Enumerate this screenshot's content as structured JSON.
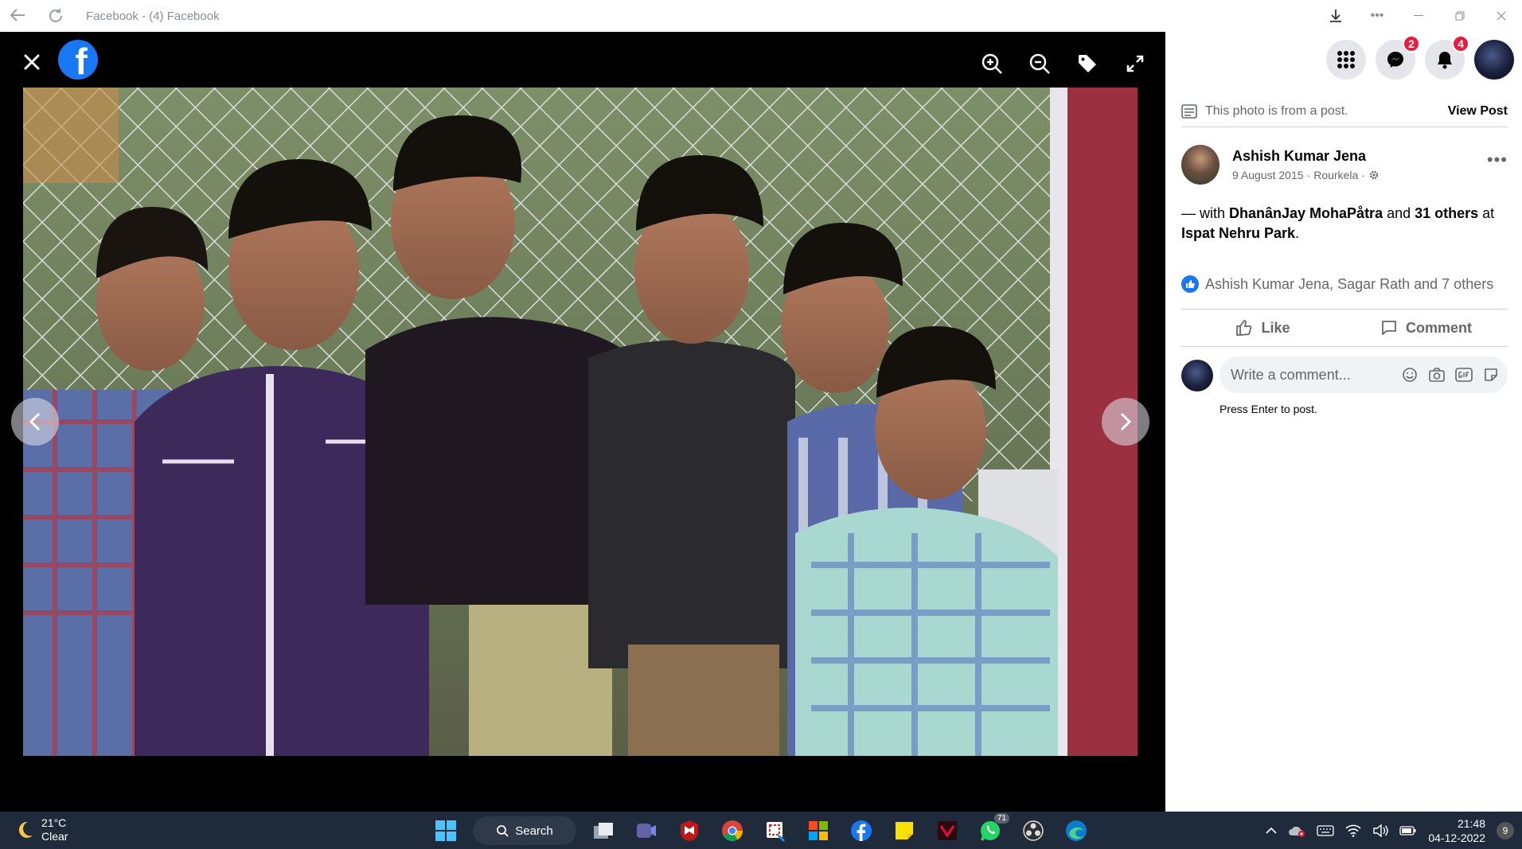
{
  "window": {
    "title": "Facebook - (4) Facebook"
  },
  "viewer": {
    "tools": [
      "zoom-in",
      "zoom-out",
      "tag",
      "fullscreen"
    ],
    "photo_alt": "Group photo of six boys in front of a chain-link fence"
  },
  "topbar": {
    "messenger_badge": "2",
    "notifications_badge": "4"
  },
  "post": {
    "photo_from_text": "This photo is from a post.",
    "view_post_label": "View Post",
    "author_name": "Ashish Kumar Jena",
    "date": "9 August 2015",
    "location": "Rourkela",
    "text_prefix": "— with ",
    "tagged_person": "DhanânJay MohaPåtra",
    "text_and": " and ",
    "tagged_others": "31 others",
    "text_at": " at",
    "place": "Ispat Nehru Park",
    "text_end": ".",
    "reactions_text": "Ashish Kumar Jena, Sagar Rath and 7 others",
    "like_label": "Like",
    "comment_label": "Comment",
    "comment_placeholder": "Write a comment...",
    "press_enter_hint": "Press Enter to post."
  },
  "taskbar": {
    "temperature": "21°C",
    "weather": "Clear",
    "search_label": "Search",
    "whatsapp_badge": "71",
    "time": "21:48",
    "date": "04-12-2022",
    "notification_count": "9"
  },
  "colors": {
    "facebook_blue": "#1877f2",
    "badge_red": "#e41e3f",
    "taskbar_bg": "#1f2a3a"
  }
}
